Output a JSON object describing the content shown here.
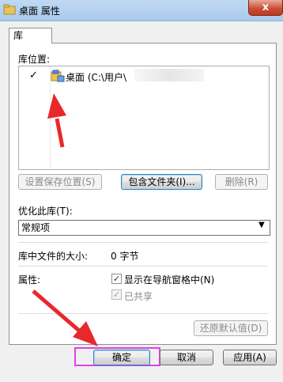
{
  "window": {
    "title": "桌面 属性",
    "close_symbol": "x"
  },
  "tab": {
    "label": "库"
  },
  "library": {
    "locations_label": "库位置:",
    "items": [
      {
        "check": "✓",
        "text": "桌面 (C:\\用户\\"
      }
    ],
    "buttons": {
      "set_save": "设置保存位置(S)",
      "include_folder": "包含文件夹(I)...",
      "remove": "删除(R)"
    }
  },
  "optimize": {
    "label": "优化此库(T):",
    "selected": "常规项"
  },
  "size": {
    "label": "库中文件的大小:",
    "value": "0 字节"
  },
  "attributes": {
    "label": "属性:",
    "show_in_nav": {
      "label": "显示在导航窗格中(N)",
      "checked": true
    },
    "shared": {
      "label": "已共享",
      "checked": true,
      "disabled": true
    }
  },
  "restore_button": "还原默认值(D)",
  "footer": {
    "ok": "确定",
    "cancel": "取消",
    "apply": "应用(A)"
  },
  "annotation_colors": {
    "arrow": "#e8282b",
    "highlight": "#e040e8"
  }
}
